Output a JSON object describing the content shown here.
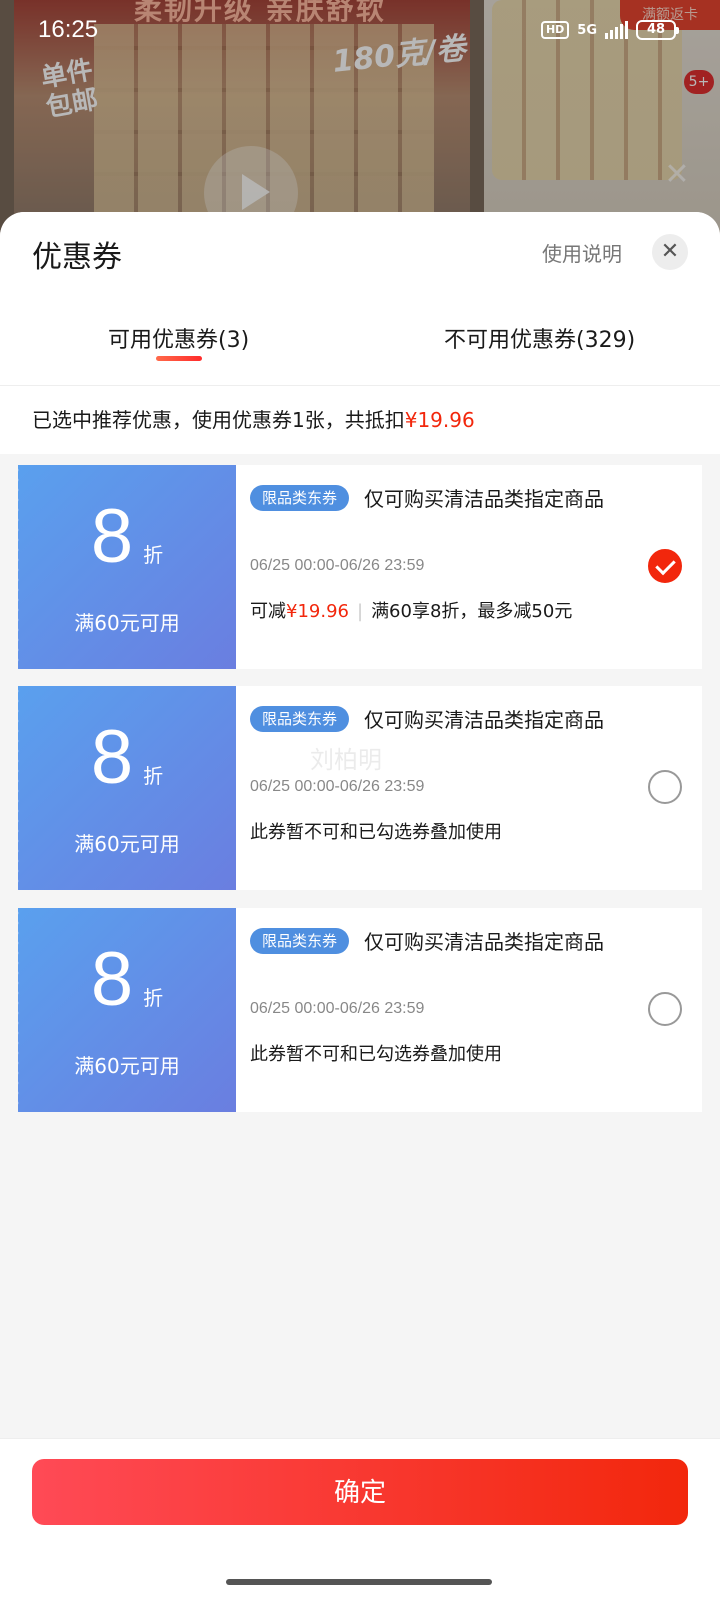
{
  "background": {
    "slogan": "柔韧升级 亲肤舒软",
    "weight": "180克/卷",
    "badge_line1": "单件",
    "badge_line2": "包邮",
    "ribbon": "满额返卡",
    "cart_count": "5+"
  },
  "status_bar": {
    "time": "16:25",
    "hd": "HD",
    "network": "5G",
    "battery": "48"
  },
  "sheet": {
    "title": "优惠券",
    "help_link": "使用说明",
    "tabs": [
      {
        "label": "可用优惠券(3)",
        "active": true
      },
      {
        "label": "不可用优惠券(329)",
        "active": false
      }
    ],
    "summary_prefix": "已选中推荐优惠，使用优惠券1张，共抵扣",
    "summary_amount": "¥19.96"
  },
  "coupons": [
    {
      "discount": "8",
      "unit": "折",
      "threshold": "满60元可用",
      "tag": "限品类东券",
      "scope": "仅可购买清洁品类指定商品",
      "validity": "06/25 00:00-06/26 23:59",
      "detail_prefix": "可减",
      "detail_amount": "¥19.96",
      "detail_rule": "满60享8折，最多减50元",
      "selected": true
    },
    {
      "discount": "8",
      "unit": "折",
      "threshold": "满60元可用",
      "tag": "限品类东券",
      "scope": "仅可购买清洁品类指定商品",
      "validity": "06/25 00:00-06/26 23:59",
      "detail": "此券暂不可和已勾选券叠加使用",
      "watermark": "刘柏明",
      "selected": false
    },
    {
      "discount": "8",
      "unit": "折",
      "threshold": "满60元可用",
      "tag": "限品类东券",
      "scope": "仅可购买清洁品类指定商品",
      "validity": "06/25 00:00-06/26 23:59",
      "detail": "此券暂不可和已勾选券叠加使用",
      "selected": false
    }
  ],
  "footer": {
    "confirm_label": "确定"
  },
  "colors": {
    "accent_red": "#f2270c",
    "coupon_blue": "#5aa0ee"
  }
}
